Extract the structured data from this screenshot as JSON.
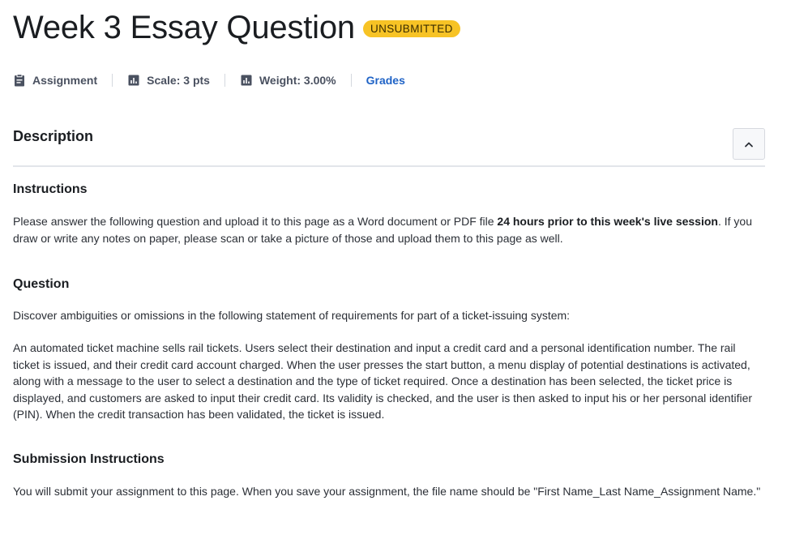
{
  "header": {
    "title": "Week 3 Essay Question",
    "status_badge": "UNSUBMITTED"
  },
  "meta": {
    "type_label": "Assignment",
    "type_icon": "clipboard-icon",
    "scale_label": "Scale: 3 pts",
    "scale_icon": "bar-chart-icon",
    "weight_label": "Weight: 3.00%",
    "weight_icon": "bar-chart-icon",
    "grades_link": "Grades"
  },
  "description": {
    "heading": "Description",
    "collapse_icon": "chevron-up-icon",
    "instructions": {
      "heading": "Instructions",
      "text_before": "Please answer the following question and upload it to this page as a Word document or PDF file ",
      "text_bold": "24 hours prior to this week's live session",
      "text_after": ". If you draw or write any notes on paper, please scan or take a picture of those and upload them to this page as well."
    },
    "question": {
      "heading": "Question",
      "intro": "Discover ambiguities or omissions in the following statement of requirements for part of a ticket-issuing system:",
      "body": "An automated ticket machine sells rail tickets. Users select their destination and input a credit card and a personal identification number. The rail ticket is issued, and their credit card account charged. When the user presses the start button, a menu display of potential destinations is activated, along with a message to the user to select a destination and the type of ticket required. Once a destination has been selected, the ticket price is displayed, and customers are asked to input their credit card. Its validity is checked, and the user is then asked to input his or her personal identifier (PIN). When the credit transaction has been validated, the ticket is issued."
    },
    "submission": {
      "heading": "Submission Instructions",
      "text": "You will submit your assignment to this page. When you save your assignment, the file name should be \"First Name_Last Name_Assignment Name.\""
    }
  },
  "colors": {
    "badge": "#f7c325",
    "link": "#1f63c6"
  }
}
